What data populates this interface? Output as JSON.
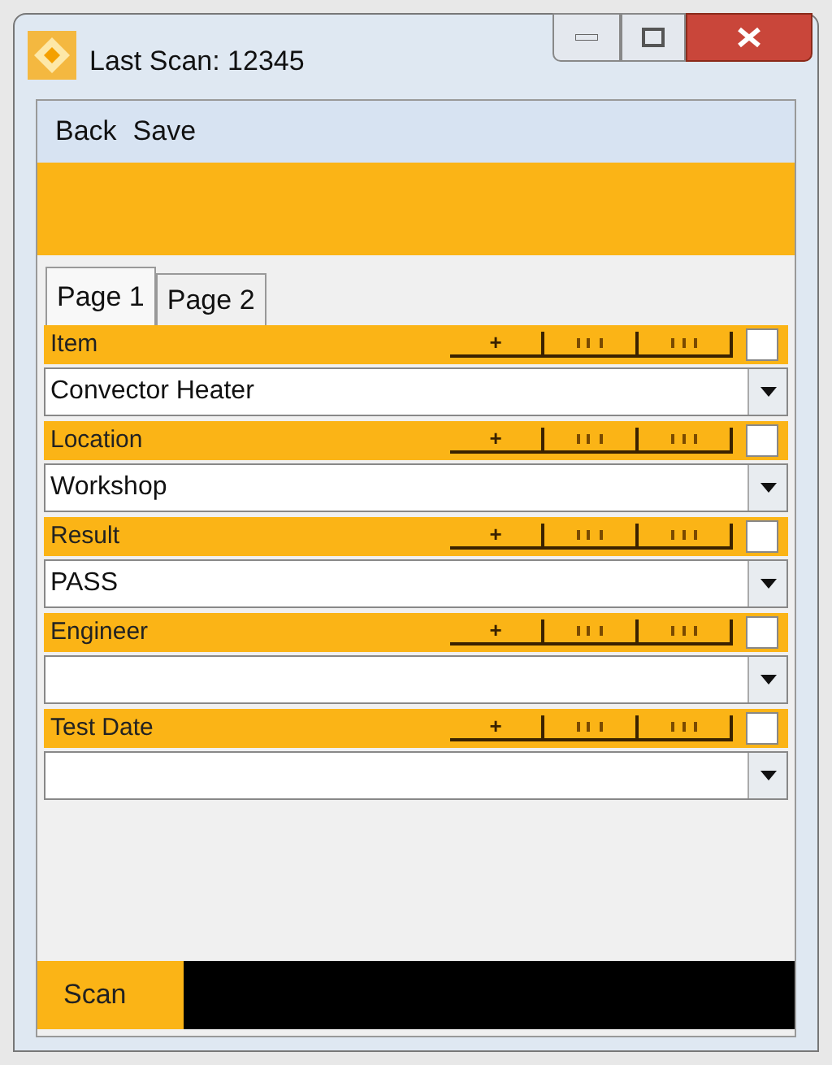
{
  "window": {
    "title": "Last Scan: 12345"
  },
  "menu": [
    "Back",
    "Save"
  ],
  "tabs": [
    {
      "label": "Page 1",
      "selected": true
    },
    {
      "label": "Page 2",
      "selected": false
    }
  ],
  "fields": [
    {
      "label": "Item",
      "add": "+",
      "checked": false,
      "value": "Convector Heater"
    },
    {
      "label": "Location",
      "add": "+",
      "checked": false,
      "value": "Workshop"
    },
    {
      "label": "Result",
      "add": "+",
      "checked": false,
      "value": "PASS"
    },
    {
      "label": "Engineer",
      "add": "+",
      "checked": false
    },
    {
      "label": "Test Date",
      "add": "+",
      "checked": false
    }
  ],
  "scan": {
    "label": "Scan"
  }
}
